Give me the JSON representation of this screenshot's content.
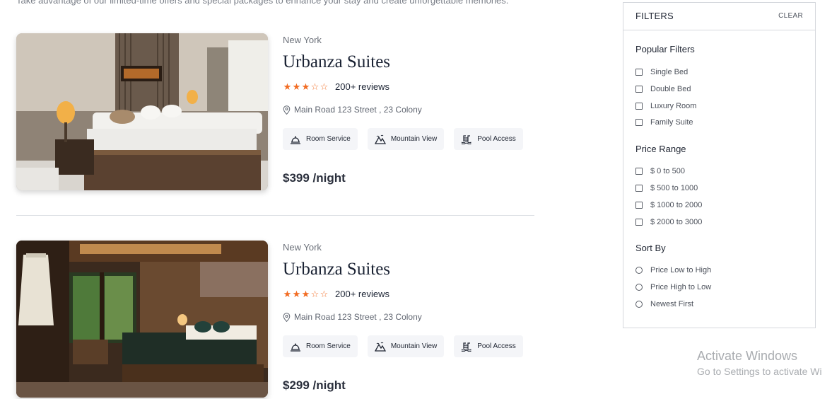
{
  "intro_text": "Take advantage of our limited-time offers and special packages to enhance your stay and create unforgettable memories.",
  "listings": [
    {
      "city": "New York",
      "name": "Urbanza Suites",
      "rating": 3,
      "rating_max": 5,
      "reviews": "200+ reviews",
      "address": "Main Road 123 Street , 23 Colony",
      "amenities": [
        {
          "label": "Room Service",
          "icon": "bell-icon"
        },
        {
          "label": "Mountain View",
          "icon": "mountain-icon"
        },
        {
          "label": "Pool Access",
          "icon": "pool-icon"
        }
      ],
      "price": "$399 /night"
    },
    {
      "city": "New York",
      "name": "Urbanza Suites",
      "rating": 3,
      "rating_max": 5,
      "reviews": "200+ reviews",
      "address": "Main Road 123 Street , 23 Colony",
      "amenities": [
        {
          "label": "Room Service",
          "icon": "bell-icon"
        },
        {
          "label": "Mountain View",
          "icon": "mountain-icon"
        },
        {
          "label": "Pool Access",
          "icon": "pool-icon"
        }
      ],
      "price": "$299 /night"
    }
  ],
  "filters": {
    "title": "FILTERS",
    "clear": "CLEAR",
    "popular": {
      "title": "Popular Filters",
      "options": [
        "Single Bed",
        "Double Bed",
        "Luxury Room",
        "Family Suite"
      ]
    },
    "price": {
      "title": "Price Range",
      "options": [
        "$ 0 to 500",
        "$ 500 to 1000",
        "$ 1000 to 2000",
        "$ 2000 to 3000"
      ]
    },
    "sort": {
      "title": "Sort By",
      "options": [
        "Price Low to High",
        "Price High to Low",
        "Newest First"
      ]
    }
  },
  "watermark": {
    "line1": "Activate Windows",
    "line2": "Go to Settings to activate Wi"
  },
  "colors": {
    "star": "#f26b21",
    "amenity_bg": "#f4f5f8",
    "border": "#d5d8dd"
  }
}
